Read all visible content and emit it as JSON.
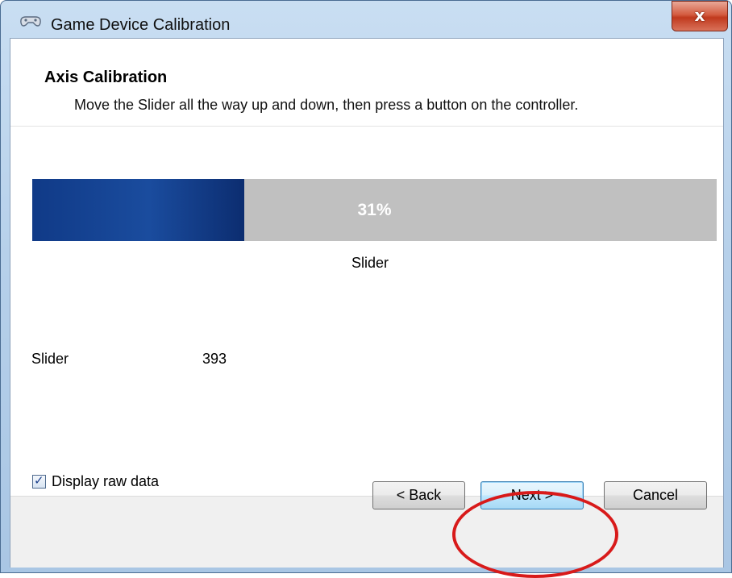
{
  "window": {
    "title": "Game Device Calibration",
    "close_glyph": "x",
    "icon": "game-controller-icon"
  },
  "header": {
    "title": "Axis Calibration",
    "instruction": "Move the Slider all the way up and down, then press a button on the controller."
  },
  "calibration": {
    "progress_fraction": 0.31,
    "progress_text": "31%",
    "axis_name": "Slider"
  },
  "raw_data": {
    "label": "Slider",
    "value": "393"
  },
  "options": {
    "display_raw_data_label": "Display raw data",
    "display_raw_data_checked": true
  },
  "buttons": {
    "back": "< Back",
    "next": "Next >",
    "cancel": "Cancel"
  },
  "colors": {
    "progress_fill": "#1a4c9e",
    "progress_track": "#c0c0c0",
    "annotation": "#d81a1a"
  }
}
